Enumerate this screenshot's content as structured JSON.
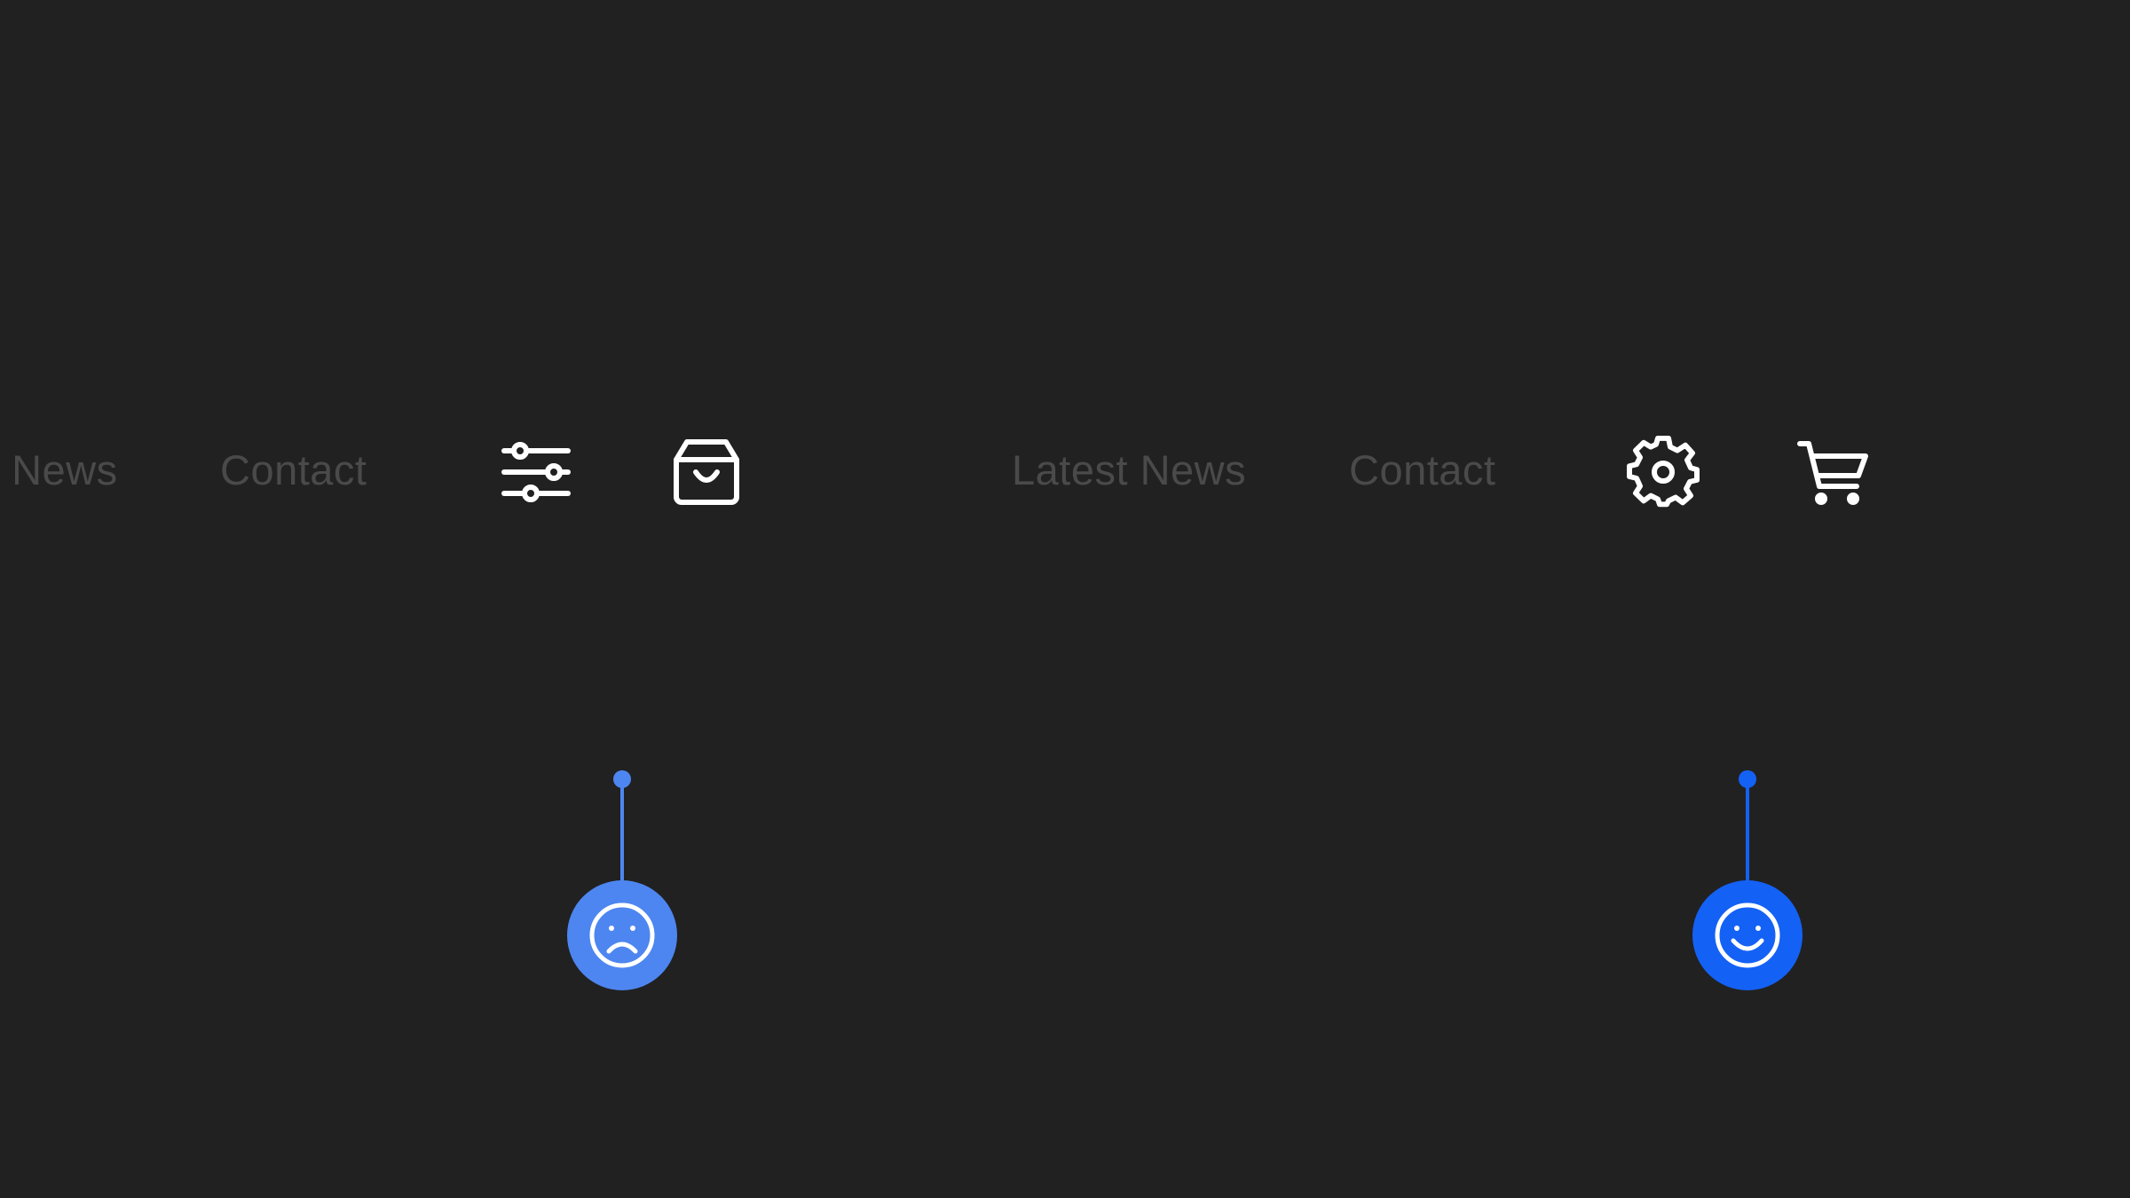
{
  "colors": {
    "background": "#212121",
    "nav_text": "#4a4a4a",
    "icon": "#ffffff",
    "sad_marker": "#4d86f0",
    "happy_marker": "#1461f5"
  },
  "left_panel": {
    "nav": {
      "latest_news_label": "t News",
      "contact_label": "Contact"
    },
    "icons": {
      "filter": "sliders-icon",
      "bag": "shopping-bag-icon"
    },
    "marker": {
      "icon": "sad-face-icon"
    }
  },
  "right_panel": {
    "nav": {
      "latest_news_label": "Latest News",
      "contact_label": "Contact"
    },
    "icons": {
      "settings": "gear-icon",
      "cart": "shopping-cart-icon"
    },
    "marker": {
      "icon": "happy-face-icon"
    }
  }
}
